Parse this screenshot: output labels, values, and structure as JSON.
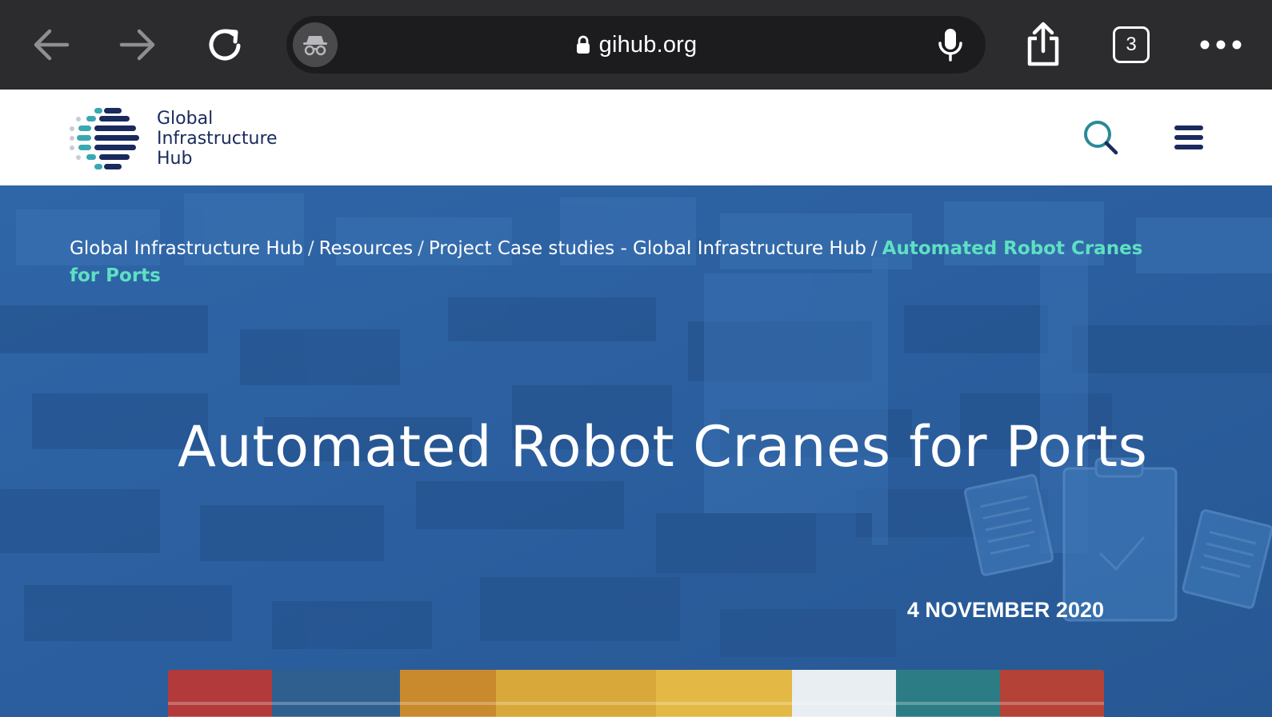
{
  "browser": {
    "url": "gihub.org",
    "tab_count": "3",
    "icons": {
      "back": "arrow-left-icon",
      "forward": "arrow-right-icon",
      "reload": "reload-icon",
      "incognito": "incognito-icon",
      "lock": "lock-icon",
      "mic": "microphone-icon",
      "share": "share-icon",
      "more": "more-dots-icon"
    }
  },
  "site": {
    "logo": {
      "line1": "Global",
      "line2": "Infrastructure",
      "line3": "Hub"
    },
    "colors": {
      "brand_navy": "#1a2a5e",
      "brand_teal": "#3aa8b0",
      "accent_green": "#5ee0c2",
      "hero_blue": "#2d5f9c"
    }
  },
  "breadcrumb": {
    "items": [
      "Global Infrastructure Hub",
      "Resources",
      "Project Case studies - Global Infrastructure Hub"
    ],
    "current": "Automated Robot Cranes for Ports",
    "separator": "/"
  },
  "article": {
    "title": "Automated Robot Cranes for Ports",
    "date": "4 NOVEMBER 2020"
  }
}
